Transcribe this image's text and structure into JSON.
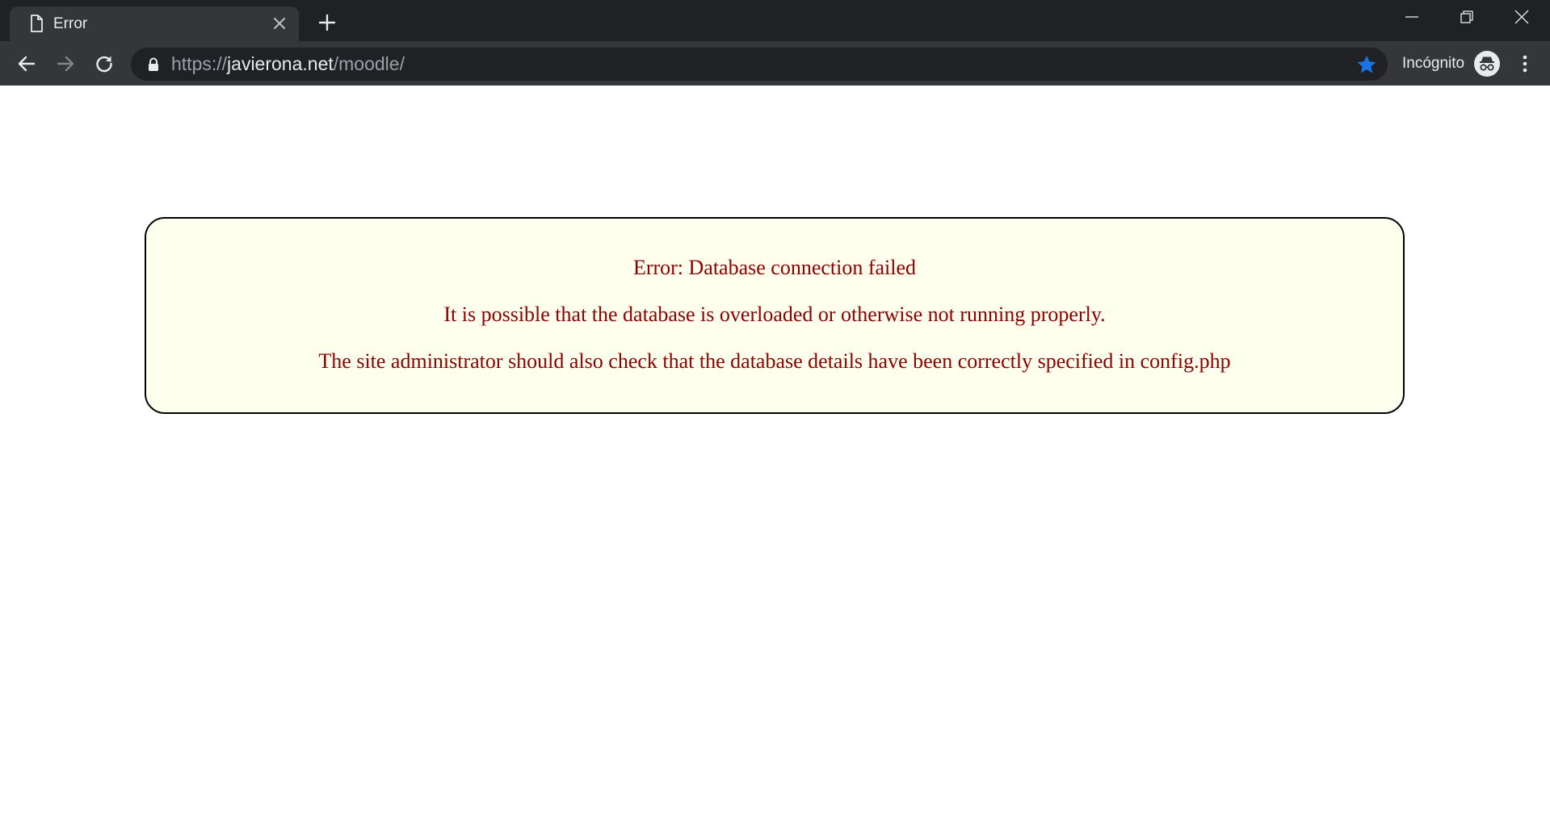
{
  "browser": {
    "tab": {
      "title": "Error",
      "icon": "page-icon"
    },
    "new_tab_icon": "plus-icon",
    "window_controls": [
      "minimize-icon",
      "restore-icon",
      "close-icon"
    ],
    "toolbar": {
      "back_icon": "back-arrow-icon",
      "forward_icon": "forward-arrow-icon",
      "reload_icon": "reload-icon"
    },
    "address_bar": {
      "scheme": "https://",
      "host": "javierona.net",
      "path": "/moodle/",
      "lock_icon": "lock-icon",
      "bookmark_icon": "star-icon",
      "bookmark_color": "#1a73e8"
    },
    "incognito": {
      "label": "Incógnito",
      "icon": "incognito-icon"
    },
    "menu_icon": "kebab-menu-icon"
  },
  "page": {
    "error_title": "Error: Database connection failed",
    "error_message": "It is possible that the database is overloaded or otherwise not running properly.",
    "error_hint": "The site administrator should also check that the database details have been correctly specified in config.php",
    "colors": {
      "box_background": "#ffffee",
      "text": "#8b0000",
      "border": "#000000"
    }
  }
}
